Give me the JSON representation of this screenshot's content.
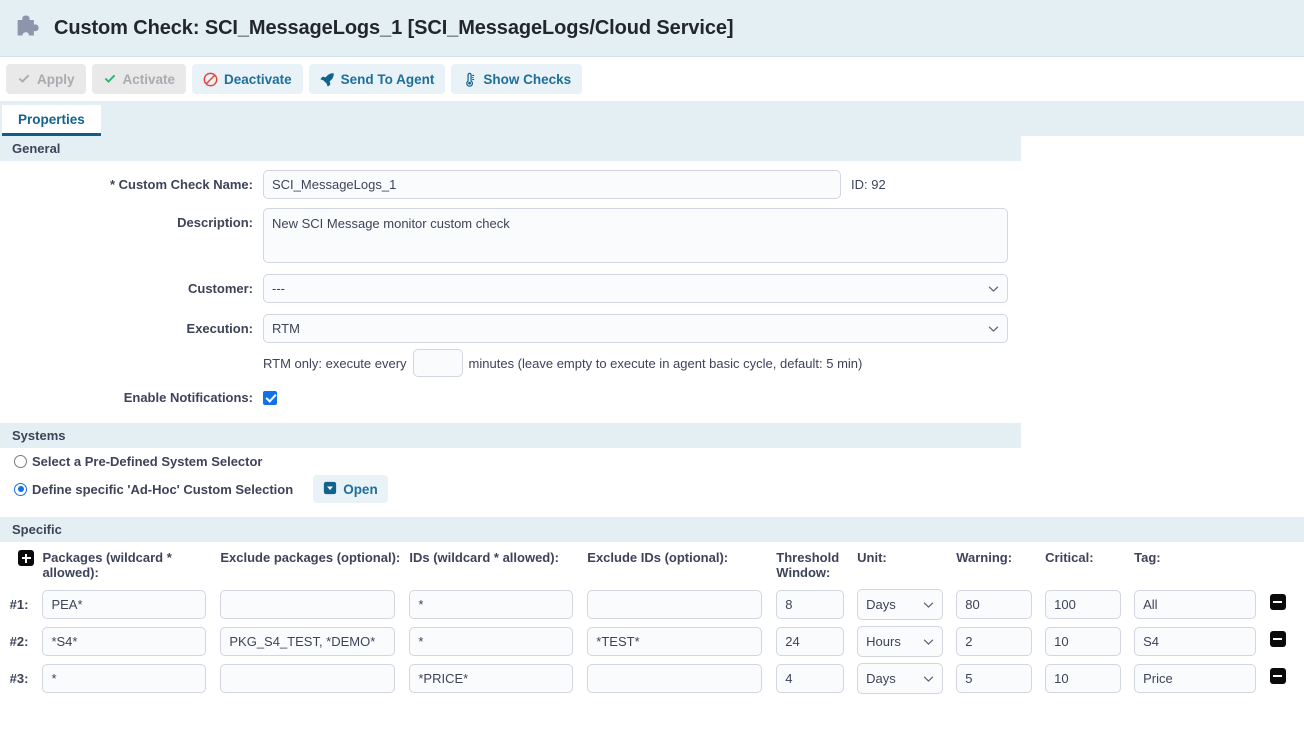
{
  "header": {
    "icon": "puzzle-piece-icon",
    "title": "Custom Check: SCI_MessageLogs_1 [SCI_MessageLogs/Cloud Service]"
  },
  "toolbar": {
    "buttons": [
      {
        "label": "Apply",
        "icon": "check-icon",
        "state": "disabled"
      },
      {
        "label": "Activate",
        "icon": "check-icon",
        "state": "disabled-green-icon"
      },
      {
        "label": "Deactivate",
        "icon": "ban-icon",
        "state": "enabled"
      },
      {
        "label": "Send To Agent",
        "icon": "rocket-icon",
        "state": "enabled"
      },
      {
        "label": "Show Checks",
        "icon": "thermometer-icon",
        "state": "enabled"
      }
    ]
  },
  "tabs": [
    {
      "label": "Properties",
      "active": true
    }
  ],
  "general": {
    "section_title": "General",
    "name_label": "* Custom Check Name:",
    "name_value": "SCI_MessageLogs_1",
    "id_text": "ID: 92",
    "description_label": "Description:",
    "description_value": "New SCI Message monitor custom check",
    "customer_label": "Customer:",
    "customer_value": "---",
    "customer_options": [
      "---"
    ],
    "execution_label": "Execution:",
    "execution_value": "RTM",
    "execution_options": [
      "RTM"
    ],
    "rtm_prefix": "RTM only: execute every",
    "rtm_minutes_value": "",
    "rtm_suffix": "minutes (leave empty to execute in agent basic cycle, default: 5 min)",
    "notifications_label": "Enable Notifications:",
    "notifications_checked": true
  },
  "systems": {
    "section_title": "Systems",
    "option_predefined": "Select a Pre-Defined System Selector",
    "option_adhoc": "Define specific 'Ad-Hoc' Custom Selection",
    "selected": "adhoc",
    "open_button": "Open",
    "open_button_icon": "dropdown-box-icon"
  },
  "specific": {
    "section_title": "Specific",
    "add_row_icon": "plus-square-icon",
    "remove_row_icon": "minus-square-icon",
    "columns": [
      "Packages (wildcard * allowed):",
      "Exclude packages (optional):",
      "IDs (wildcard * allowed):",
      "Exclude IDs (optional):",
      "Threshold Window:",
      "Unit:",
      "Warning:",
      "Critical:",
      "Tag:"
    ],
    "unit_options": [
      "Days",
      "Hours"
    ],
    "rows": [
      {
        "index": "#1:",
        "packages": "PEA*",
        "exclude_packages": "",
        "ids": "*",
        "exclude_ids": "",
        "threshold_window": "8",
        "unit": "Days",
        "warning": "80",
        "critical": "100",
        "tag": "All"
      },
      {
        "index": "#2:",
        "packages": "*S4*",
        "exclude_packages": "PKG_S4_TEST, *DEMO*",
        "ids": "*",
        "exclude_ids": "*TEST*",
        "threshold_window": "24",
        "unit": "Hours",
        "warning": "2",
        "critical": "10",
        "tag": "S4"
      },
      {
        "index": "#3:",
        "packages": "*",
        "exclude_packages": "",
        "ids": "*PRICE*",
        "exclude_ids": "",
        "threshold_window": "4",
        "unit": "Days",
        "warning": "5",
        "critical": "10",
        "tag": "Price"
      }
    ]
  },
  "colors": {
    "header_band": "#e4eff4",
    "accent_blue": "#1e6f9a",
    "tab_underline": "#0f5e87",
    "danger_red": "#e8443a",
    "success_green": "#2ab26b",
    "checkbox_blue": "#1271e8",
    "text": "#3d4359"
  }
}
